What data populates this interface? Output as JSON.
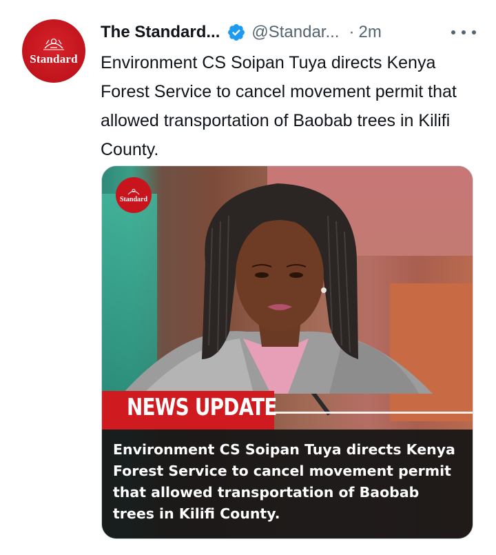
{
  "tweet": {
    "avatar": {
      "label": "Standard",
      "color": "#c8141c"
    },
    "display_name": "The Standard...",
    "verified_icon": "verified-badge-icon",
    "handle": "@Standar...",
    "separator": "·",
    "time": "2m",
    "more_icon": "more-horizontal-icon",
    "text": "Environment CS Soipan Tuya directs Kenya Forest Service to cancel movement permit that allowed transportation of Baobab trees in Kilifi County."
  },
  "media": {
    "logo_label": "Standard",
    "banner": "NEWS UPDATE",
    "caption": "Environment CS Soipan Tuya directs Kenya Forest Service to cancel movement permit that allowed transportation of Baobab trees in Kilifi County.",
    "colors": {
      "banner_red": "#cf1b20",
      "caption_bg": "#161616",
      "brand_red": "#c8141c",
      "verified_blue": "#1d9bf0"
    }
  }
}
